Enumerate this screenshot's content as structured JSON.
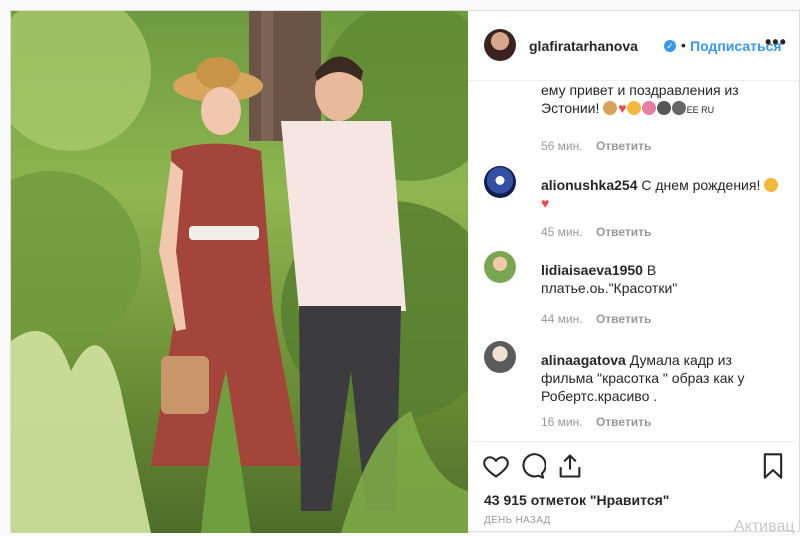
{
  "header": {
    "username": "glafiratarhanova",
    "verified_mark": "✓",
    "separator": "•",
    "follow_label": "Подписаться",
    "more_label": "•••"
  },
  "comments": [
    {
      "user": "",
      "text": "ему привет и поздравления из Эстонии!",
      "emoji_suffix": "EE RU",
      "time": "56 мин.",
      "reply": "Ответить"
    },
    {
      "user": "alionushka254",
      "text": "С днем рождения!",
      "time": "45 мин.",
      "reply": "Ответить"
    },
    {
      "user": "lidiaisaeva1950",
      "text": "В платье.оь.\"Красотки\"",
      "time": "44 мин.",
      "reply": "Ответить"
    },
    {
      "user": "alinaagatova",
      "text": "Думала кадр из фильма \"красотка \" образ как у Робертс.красиво .",
      "time": "16 мин.",
      "reply": "Ответить"
    }
  ],
  "actions": {
    "likes_text": "43 915 отметок \"Нравится\"",
    "time_ago": "ДЕНЬ НАЗАД"
  },
  "watermark": "Активац",
  "icons": [
    "heart-icon",
    "comment-icon",
    "share-icon",
    "bookmark-icon",
    "verified-badge-icon",
    "more-options-icon"
  ],
  "colors": {
    "link": "#3897f0",
    "heart": "#ed4956",
    "muted": "#999999"
  }
}
